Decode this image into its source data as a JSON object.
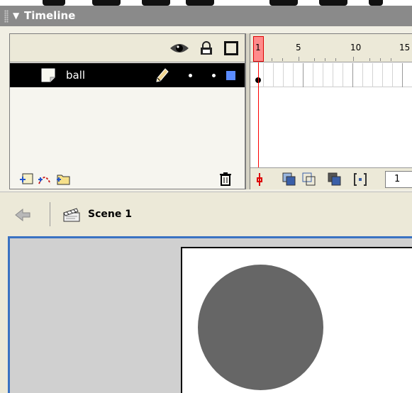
{
  "panel": {
    "title": "Timeline"
  },
  "layers": [
    {
      "name": "ball",
      "color": "#5b8cff"
    }
  ],
  "ruler": {
    "numbers": [
      "1",
      "5",
      "10",
      "15"
    ]
  },
  "frames_footer": {
    "current_frame": "1"
  },
  "edit_bar": {
    "scene_label": "Scene 1"
  },
  "stage": {
    "background": "#ffffff",
    "object": {
      "type": "circle",
      "color": "#666666"
    }
  },
  "colors": {
    "header": "#8a8a8a",
    "chrome": "#ece9d8",
    "playhead": "#ff0000",
    "stage_border": "#3a72c2"
  }
}
